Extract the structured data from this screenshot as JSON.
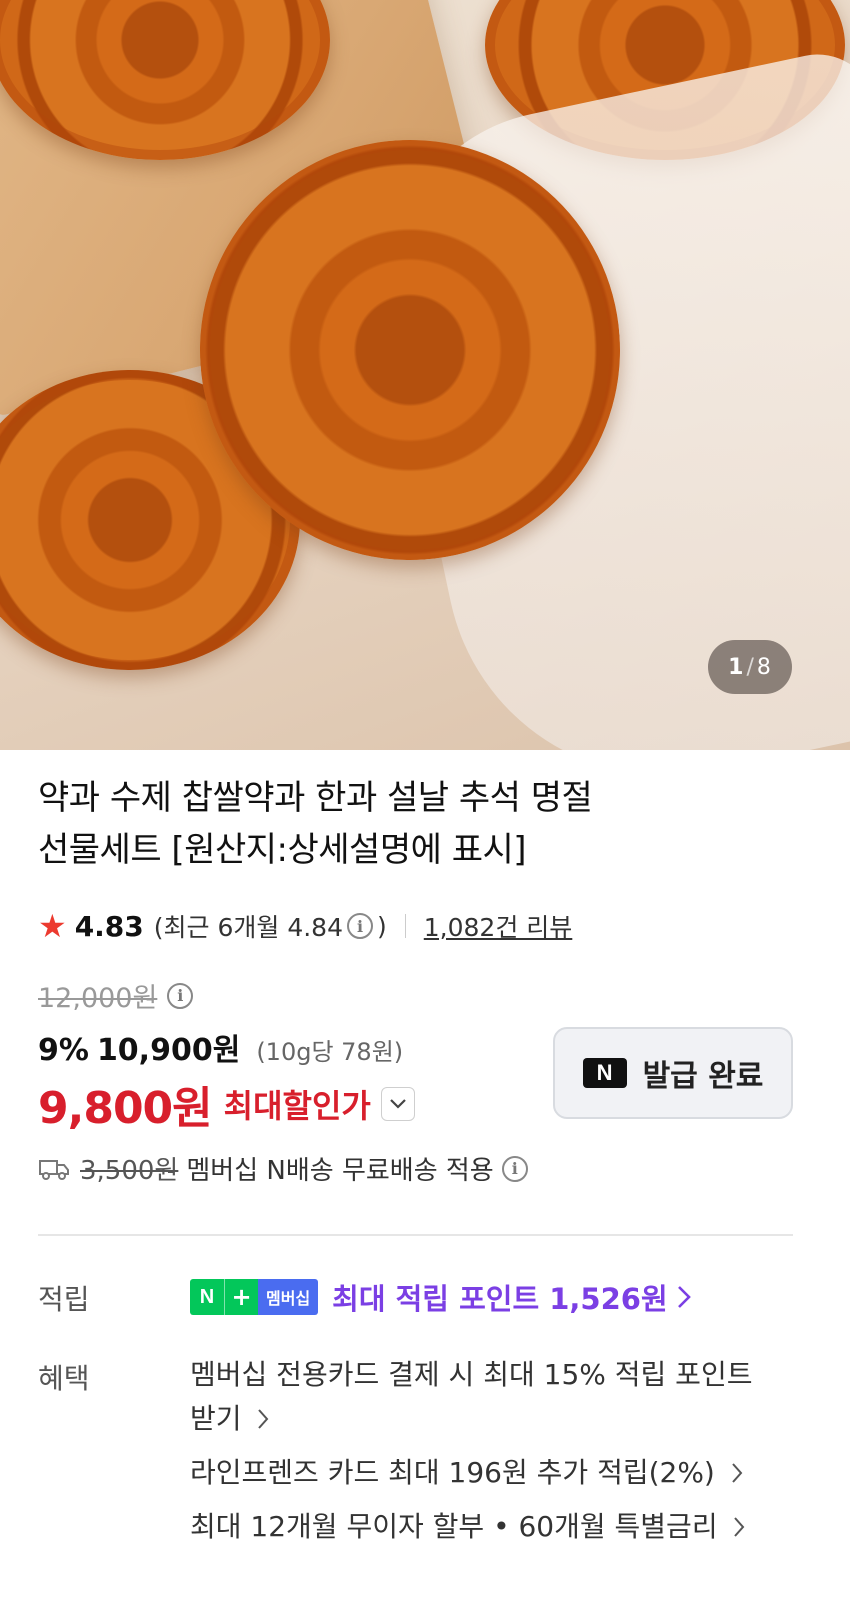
{
  "gallery": {
    "current": "1",
    "separator": "/",
    "total": "8"
  },
  "product": {
    "title_line1": "약과 수제 찹쌀약과 한과 설날 추석 명절",
    "title_line2": "선물세트 [원산지:상세설명에 표시]"
  },
  "rating": {
    "score": "4.83",
    "recent_prefix": "(최근 6개월 4.84",
    "recent_suffix": ")",
    "reviews": "1,082건 리뷰"
  },
  "price": {
    "original": "12,000원",
    "discount_pct": "9%",
    "sale": "10,900원",
    "unit_price": "(10g당 78원)",
    "max_discount": "9,800원",
    "max_label": "최대할인가"
  },
  "coupon": {
    "logo": "N",
    "label": "발급 완료"
  },
  "shipping": {
    "fee_original": "3,500원",
    "text": "멤버십 N배송 무료배송 적용"
  },
  "points": {
    "label": "적립",
    "badge_n": "N",
    "badge_plus": "+",
    "badge_membership": "멤버십",
    "text": "최대 적립 포인트 1,526원"
  },
  "benefits": {
    "label": "혜택",
    "items": [
      "멤버십 전용카드 결제 시 최대 15% 적립 포인트",
      "받기",
      "라인프렌즈 카드 최대 196원 추가 적립(2%)",
      "최대 12개월 무이자 할부 • 60개월 특별금리"
    ]
  },
  "icons": {
    "star": "star-icon",
    "info": "info-icon",
    "truck": "truck-icon",
    "chevron": "chevron-right-icon"
  },
  "colors": {
    "discount_red": "#d81f2c",
    "points_purple": "#7b3fe4",
    "naver_green": "#03c75a",
    "star": "#ec3a2f"
  }
}
